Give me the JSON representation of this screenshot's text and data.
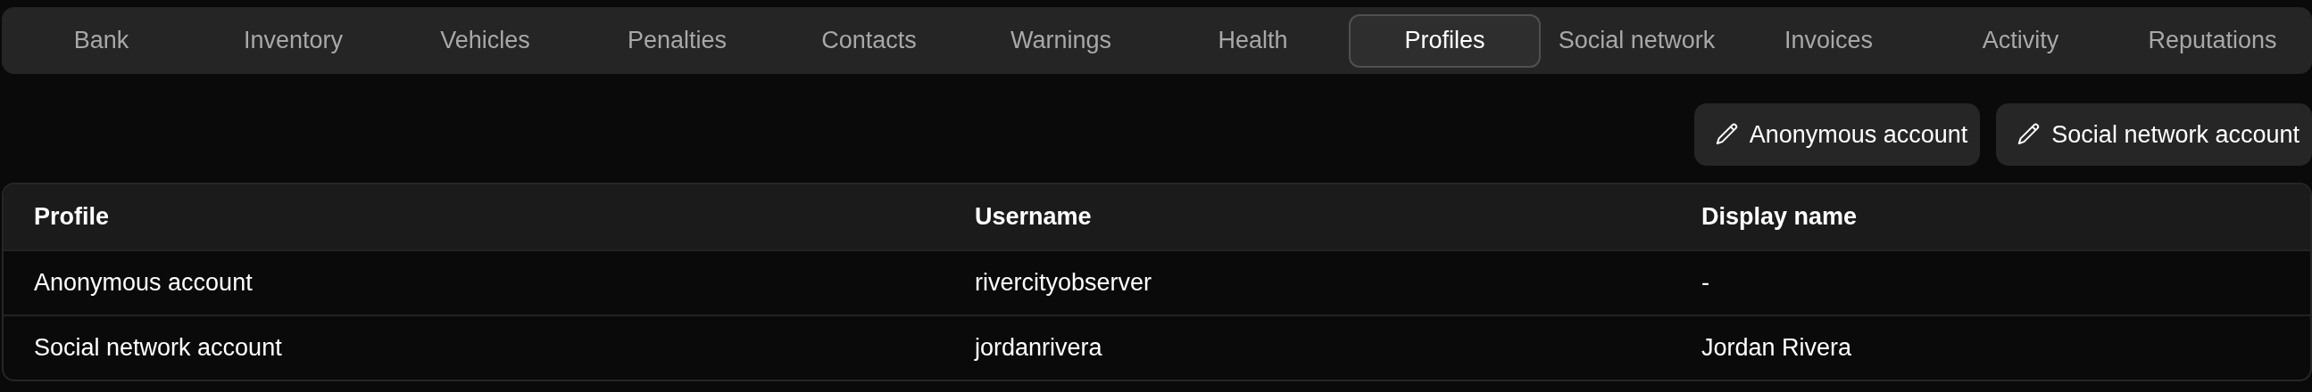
{
  "tabs": [
    {
      "label": "Bank",
      "selected": false
    },
    {
      "label": "Inventory",
      "selected": false
    },
    {
      "label": "Vehicles",
      "selected": false
    },
    {
      "label": "Penalties",
      "selected": false
    },
    {
      "label": "Contacts",
      "selected": false
    },
    {
      "label": "Warnings",
      "selected": false
    },
    {
      "label": "Health",
      "selected": false
    },
    {
      "label": "Profiles",
      "selected": true
    },
    {
      "label": "Social network",
      "selected": false
    },
    {
      "label": "Invoices",
      "selected": false
    },
    {
      "label": "Activity",
      "selected": false
    },
    {
      "label": "Reputations",
      "selected": false
    }
  ],
  "actions": [
    {
      "label": "Anonymous account"
    },
    {
      "label": "Social network account"
    }
  ],
  "table": {
    "columns": [
      "Profile",
      "Username",
      "Display name"
    ],
    "rows": [
      [
        "Anonymous account",
        "rivercityobserver",
        "-"
      ],
      [
        "Social network account",
        "jordanrivera",
        "Jordan Rivera"
      ]
    ]
  }
}
